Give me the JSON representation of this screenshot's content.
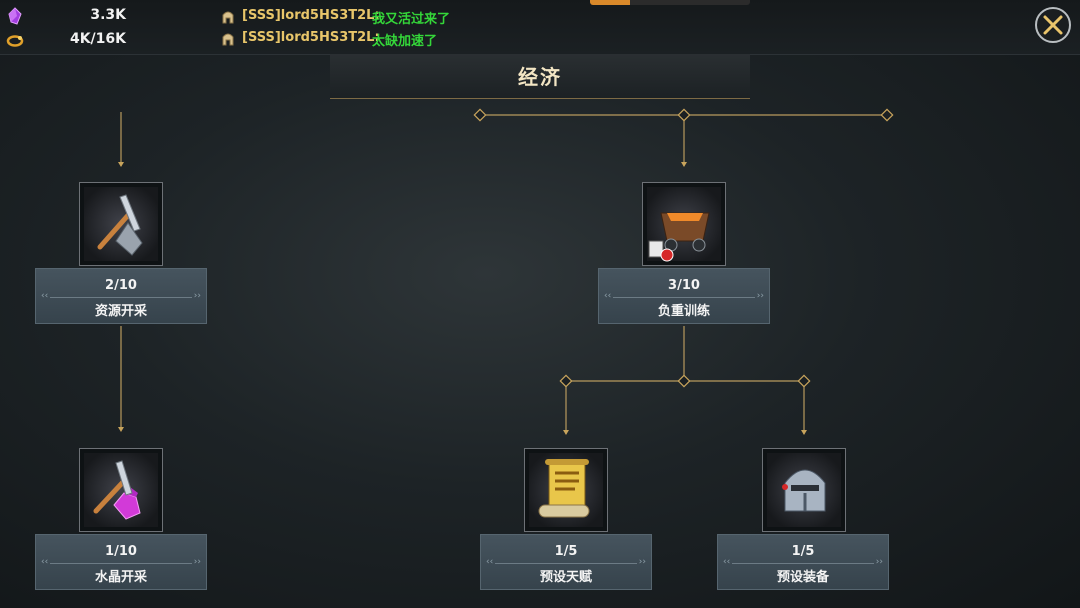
{
  "resources": [
    {
      "icon": "purple-crystal-icon",
      "value": "3.3K"
    },
    {
      "icon": "golden-ring-icon",
      "value": "4K/16K"
    }
  ],
  "chat": [
    {
      "icon": "chat-helmet-icon",
      "name": "[SSS]lord5HS3T2L:",
      "message": "我又活过来了"
    },
    {
      "icon": "chat-helmet-icon",
      "name": "[SSS]lord5HS3T2L:",
      "message": "太缺加速了"
    }
  ],
  "title": "经济",
  "colors": {
    "accent_gold": "#c8a45c",
    "chat_name": "#e8c66a",
    "chat_message": "#34d639",
    "panel": "#3e4b54"
  },
  "nodes": {
    "resource_mining": {
      "level": "2/10",
      "name": "资源开采",
      "icon": "pickaxe-icon"
    },
    "crystal_mining": {
      "level": "1/10",
      "name": "水晶开采",
      "icon": "crystal-pickaxe-icon"
    },
    "load_training": {
      "level": "3/10",
      "name": "负重训练",
      "icon": "mine-cart-icon"
    },
    "preset_talent": {
      "level": "1/5",
      "name": "预设天赋",
      "icon": "scroll-icon"
    },
    "preset_equipment": {
      "level": "1/5",
      "name": "预设装备",
      "icon": "helmet-icon"
    }
  }
}
